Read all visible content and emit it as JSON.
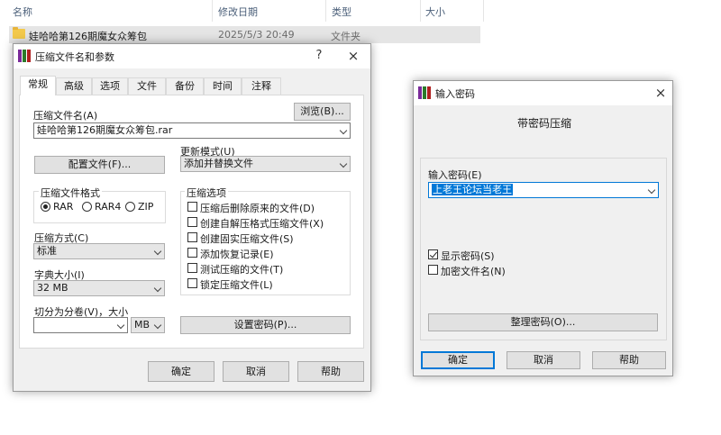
{
  "explorer": {
    "columns": [
      "名称",
      "修改日期",
      "类型",
      "大小"
    ],
    "row": {
      "name": "娃哈哈第126期魔女众筹包",
      "date": "2025/5/3 20:49",
      "type": "文件夹"
    }
  },
  "archive_dialog": {
    "title": "压缩文件名和参数",
    "help_btn": "?",
    "close_btn": "×",
    "tabs": [
      "常规",
      "高级",
      "选项",
      "文件",
      "备份",
      "时间",
      "注释"
    ],
    "archive_name_label": "压缩文件名(A)",
    "browse_label": "浏览(B)...",
    "archive_name_value": "娃哈哈第126期魔女众筹包.rar",
    "profiles_label": "配置文件(F)...",
    "update_mode_label": "更新模式(U)",
    "update_mode_value": "添加并替换文件",
    "format_group": "压缩文件格式",
    "formats": [
      "RAR",
      "RAR4",
      "ZIP"
    ],
    "selected_format": "RAR",
    "method_label": "压缩方式(C)",
    "method_value": "标准",
    "dict_label": "字典大小(I)",
    "dict_value": "32 MB",
    "split_label": "切分为分卷(V)，大小",
    "split_value": "",
    "split_unit": "MB",
    "options_group": "压缩选项",
    "options": [
      {
        "label": "压缩后删除原来的文件(D)",
        "checked": false
      },
      {
        "label": "创建自解压格式压缩文件(X)",
        "checked": false
      },
      {
        "label": "创建固实压缩文件(S)",
        "checked": false
      },
      {
        "label": "添加恢复记录(E)",
        "checked": false
      },
      {
        "label": "测试压缩的文件(T)",
        "checked": false
      },
      {
        "label": "锁定压缩文件(L)",
        "checked": false
      }
    ],
    "set_password_label": "设置密码(P)...",
    "ok_label": "确定",
    "cancel_label": "取消",
    "help_label": "帮助"
  },
  "password_dialog": {
    "title": "输入密码",
    "close_btn": "×",
    "heading": "带密码压缩",
    "enter_password_label": "输入密码(E)",
    "password_value": "上老王论坛当老王",
    "show_password_label": "显示密码(S)",
    "show_password_checked": true,
    "encrypt_names_label": "加密文件名(N)",
    "encrypt_names_checked": false,
    "organize_label": "整理密码(O)...",
    "ok_label": "确定",
    "cancel_label": "取消",
    "help_label": "帮助"
  }
}
